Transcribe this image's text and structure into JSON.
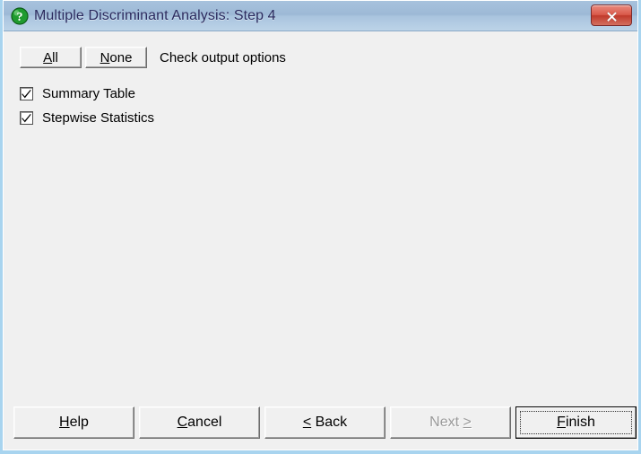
{
  "window": {
    "title": "Multiple Discriminant Analysis: Step 4",
    "icon": "question-mark-icon",
    "close_label": "x",
    "accent_title_color": "#2a2a5e",
    "close_button_color": "#c0392b",
    "titlebar_color": "#a7c2dd",
    "body_color": "#f0f0f0"
  },
  "toolbar": {
    "all_accel": "A",
    "all_rest": "ll",
    "none_accel": "N",
    "none_rest": "one",
    "instruction": "Check output options"
  },
  "options": [
    {
      "label": "Summary Table",
      "checked": true
    },
    {
      "label": "Stepwise Statistics",
      "checked": true
    }
  ],
  "buttons": {
    "help_accel": "H",
    "help_rest": "elp",
    "cancel_accel": "C",
    "cancel_rest": "ancel",
    "back_accel": "<",
    "back_rest": " Back",
    "next_pre": "Next ",
    "next_accel": ">",
    "next_disabled": true,
    "finish_accel": "F",
    "finish_rest": "inish",
    "finish_is_default": true
  }
}
